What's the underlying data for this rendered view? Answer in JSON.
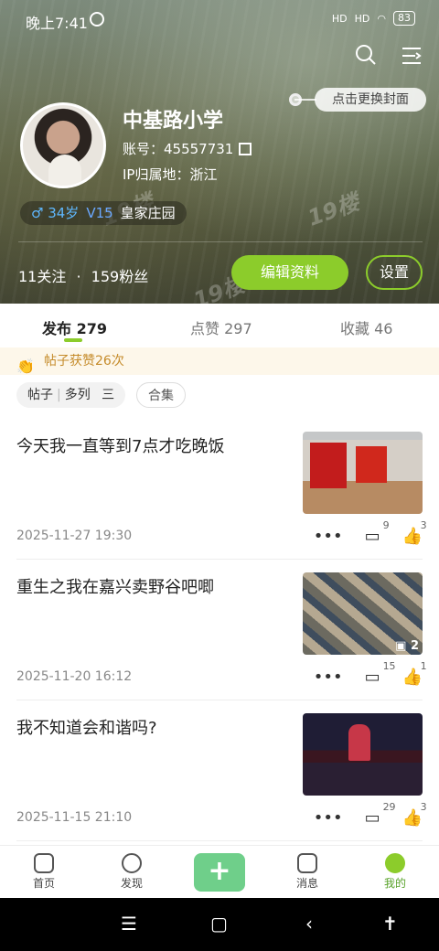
{
  "status_bar": {
    "time": "晚上7:41",
    "signal1": "HD",
    "signal2": "HD",
    "battery": "83"
  },
  "cover": {
    "change_cover_label": "点击更换封面"
  },
  "profile": {
    "name": "中基路小学",
    "account": "账号：45557731",
    "ip_location": "IP归属地：浙江",
    "gender_age": "♂ 34岁",
    "level": "V15",
    "title_badge": "皇家庄园",
    "following": "11关注",
    "followers_sep": "·",
    "followers": "159粉丝",
    "edit_label": "编辑资料",
    "settings_label": "设置"
  },
  "watermark": "19楼",
  "tabs": [
    {
      "label": "发布",
      "count": "279"
    },
    {
      "label": "点赞",
      "count": "297"
    },
    {
      "label": "收藏",
      "count": "46"
    }
  ],
  "notice": "帖子获赞26次",
  "filter_chips": {
    "chip1_a": "帖子",
    "chip1_b": "多列",
    "chip1_c": "三",
    "chip2": "合集"
  },
  "posts": [
    {
      "title": "今天我一直等到7点才吃晚饭",
      "date": "2025-11-27 19:30",
      "comments": "9",
      "likes": "3",
      "image_count": ""
    },
    {
      "title": "重生之我在嘉兴卖野谷吧唧",
      "date": "2025-11-20 16:12",
      "comments": "15",
      "likes": "1",
      "image_count": "2"
    },
    {
      "title": "我不知道会和谐吗?",
      "date": "2025-11-15 21:10",
      "comments": "29",
      "likes": "3",
      "image_count": ""
    }
  ],
  "bottom_nav": [
    {
      "label": "首页"
    },
    {
      "label": "发现"
    },
    {
      "label": "消息"
    },
    {
      "label": "我的"
    }
  ],
  "colors": {
    "accent": "#8ccc2b",
    "plus_button": "#6fcf8a",
    "notice_text": "#c58b2a"
  }
}
